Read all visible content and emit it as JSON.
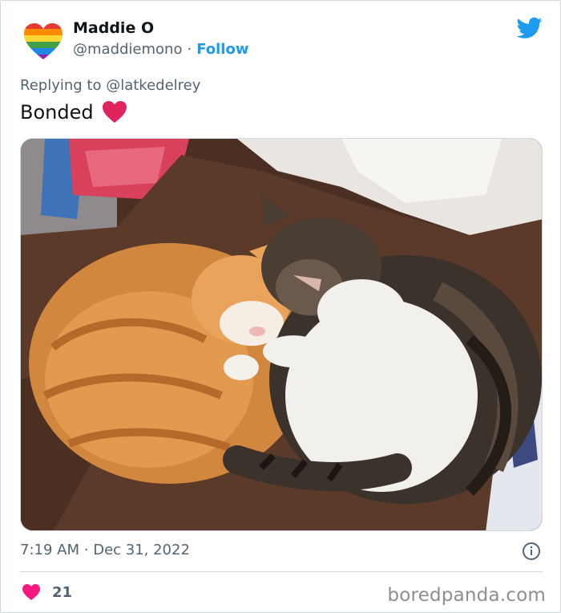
{
  "author": {
    "name": "Maddie O",
    "handle": "@maddiemono",
    "separator": "·",
    "follow_label": "Follow",
    "avatar_icon": "rainbow-heart-icon"
  },
  "brand_icon": "twitter-bird-icon",
  "reply": {
    "prefix": "Replying to",
    "mention": "@latkedelrey"
  },
  "tweet": {
    "text": "Bonded",
    "emoji_icon": "red-heart-icon"
  },
  "media": {
    "icon": "photo-two-cats-cuddling"
  },
  "meta": {
    "time": "7:19 AM",
    "separator": "·",
    "date": "Dec 31, 2022",
    "info_icon": "info-icon"
  },
  "engagement": {
    "likes": "21",
    "like_icon": "heart-icon"
  },
  "watermark": "boredpanda.com",
  "colors": {
    "accent": "#1d9bf0",
    "like": "#f91880",
    "heart_emoji": "#e0245e",
    "secondary_text": "#536471"
  }
}
